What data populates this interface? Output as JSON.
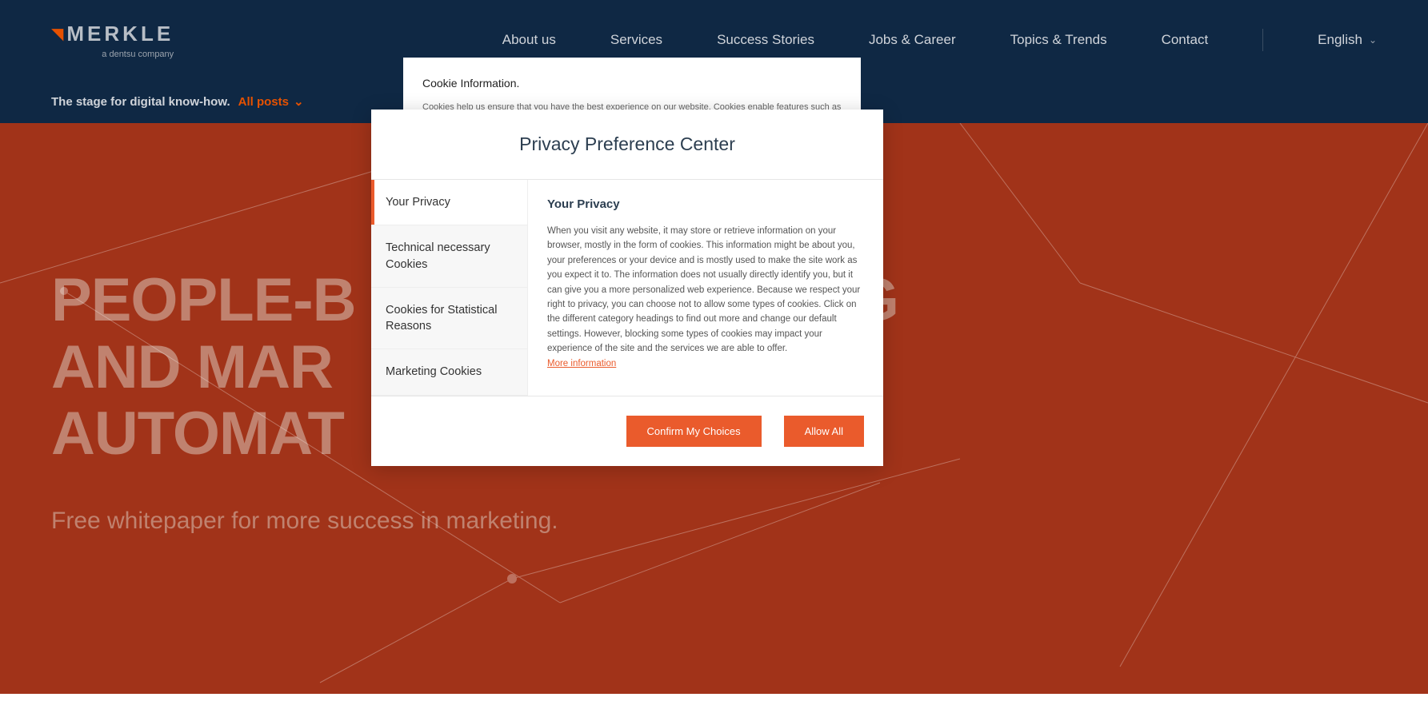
{
  "header": {
    "logo_text": "MERKLE",
    "logo_sub": "a dentsu company",
    "nav": {
      "about": "About us",
      "services": "Services",
      "success": "Success Stories",
      "jobs": "Jobs & Career",
      "topics": "Topics & Trends",
      "contact": "Contact",
      "language": "English"
    }
  },
  "subheader": {
    "text": "The stage for digital know-how.",
    "link": "All posts"
  },
  "hero": {
    "title_line1": "PEOPLE-B",
    "title_line1_rest": "NG",
    "title_line2": "AND MAR",
    "title_line3": "AUTOMAT",
    "subtitle": "Free whitepaper for more success in marketing."
  },
  "cookie_banner": {
    "title": "Cookie Information.",
    "text": "Cookies help us ensure that you have the best experience on our website. Cookies enable features such as social media interactions, personalized messaging, and analytics. To enable cookies, please click on \"Accept All Cookies\""
  },
  "modal": {
    "title": "Privacy Preference Center",
    "tabs": {
      "privacy": "Your Privacy",
      "technical": "Technical necessary Cookies",
      "statistical": "Cookies for Statistical Reasons",
      "marketing": "Marketing Cookies"
    },
    "content": {
      "title": "Your Privacy",
      "text": "When you visit any website, it may store or retrieve information on your browser, mostly in the form of cookies. This information might be about you, your preferences or your device and is mostly used to make the site work as you expect it to. The information does not usually directly identify you, but it can give you a more personalized web experience. Because we respect your right to privacy, you can choose not to allow some types of cookies. Click on the different category headings to find out more and change our default settings. However, blocking some types of cookies may impact your experience of the site and the services we are able to offer.",
      "more_link": "More information"
    },
    "buttons": {
      "confirm": "Confirm My Choices",
      "allow": "Allow All"
    }
  }
}
